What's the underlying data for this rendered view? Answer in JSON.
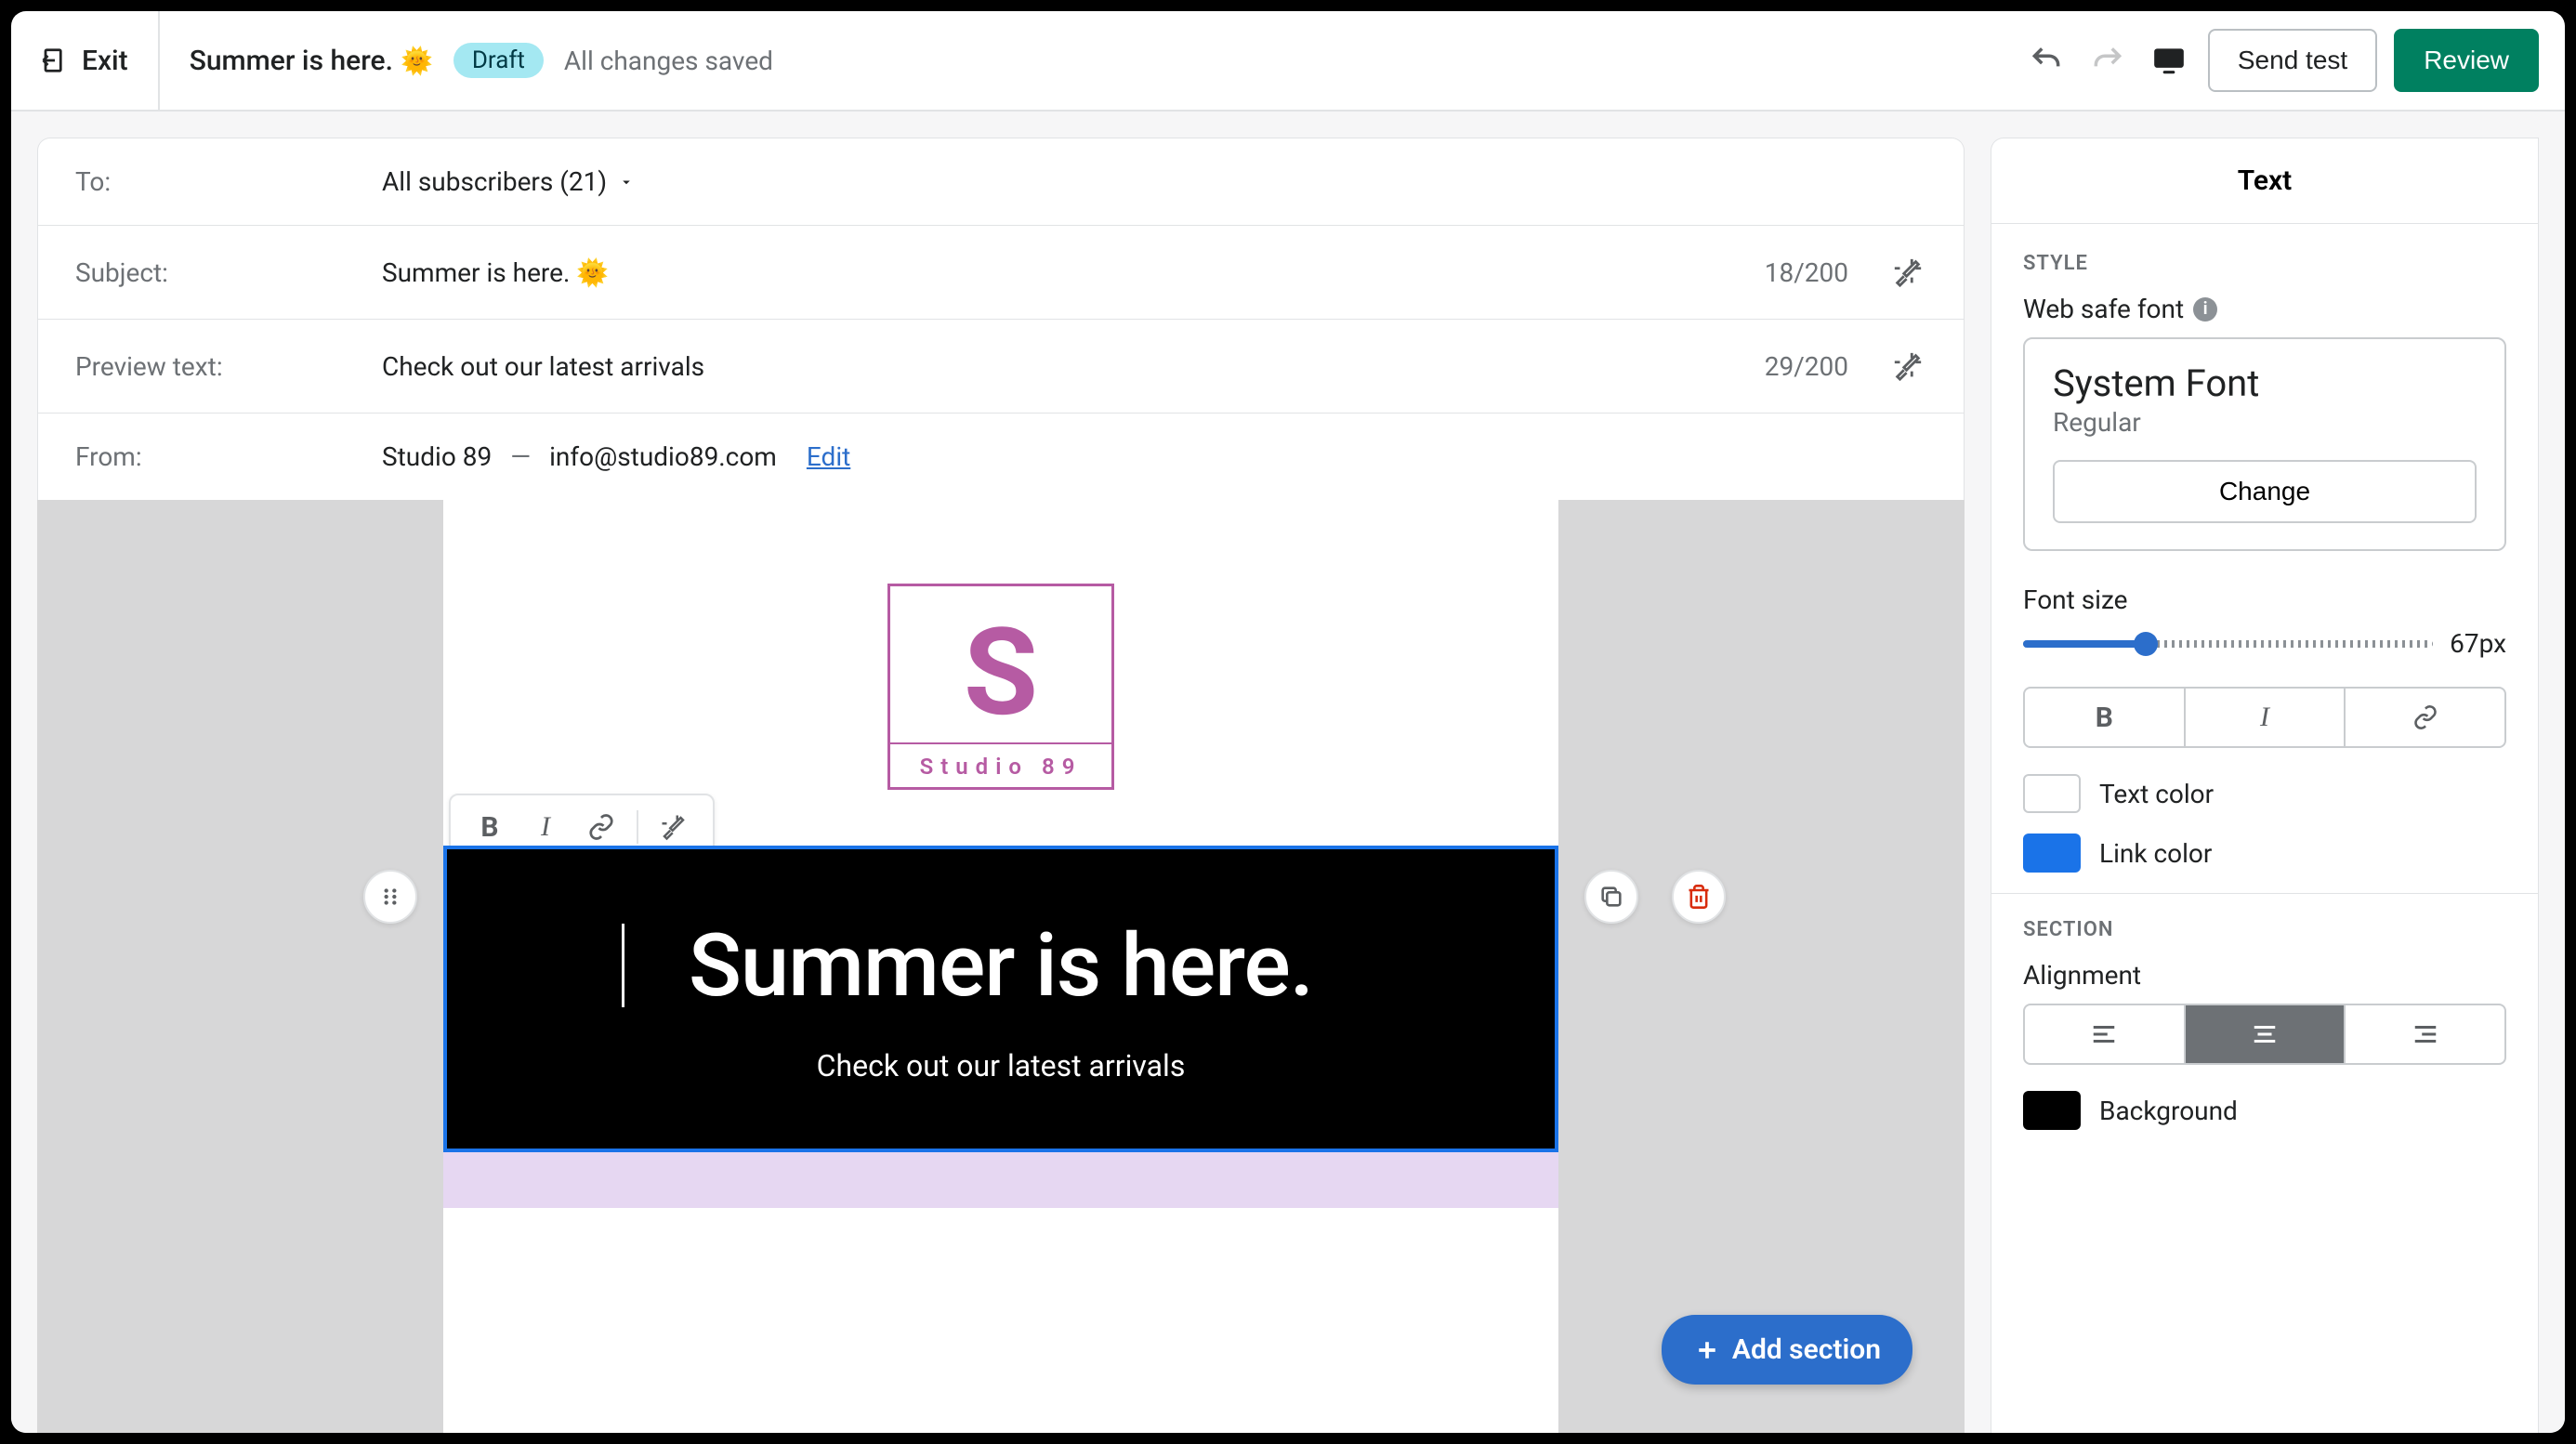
{
  "topbar": {
    "exit": "Exit",
    "title": "Summer is here.",
    "emoji": "🌞",
    "status_badge": "Draft",
    "save_status": "All changes saved",
    "send_test": "Send test",
    "review": "Review"
  },
  "meta": {
    "to_label": "To:",
    "to_value": "All subscribers (21)",
    "subject_label": "Subject:",
    "subject_value": "Summer is here. 🌞",
    "subject_count": "18/200",
    "preview_label": "Preview text:",
    "preview_value": "Check out our latest arrivals",
    "preview_count": "29/200",
    "from_label": "From:",
    "from_name": "Studio 89",
    "from_sep": "—",
    "from_email": "info@studio89.com",
    "from_edit": "Edit"
  },
  "canvas": {
    "logo_letter": "S",
    "logo_name": "Studio 89",
    "hero_title": "Summer is here.",
    "hero_sub": "Check out our latest arrivals",
    "add_section": "Add section"
  },
  "sidebar": {
    "title": "Text",
    "style_label": "STYLE",
    "websafe_label": "Web safe font",
    "font_name": "System Font",
    "font_weight": "Regular",
    "change_btn": "Change",
    "fontsize_label": "Font size",
    "fontsize_value": "67px",
    "fontsize_pct": 30,
    "text_color_label": "Text color",
    "text_color": "#ffffff",
    "link_color_label": "Link color",
    "link_color": "#1a73e8",
    "section_label": "SECTION",
    "alignment_label": "Alignment",
    "bg_label": "Background",
    "bg_color": "#000000"
  }
}
